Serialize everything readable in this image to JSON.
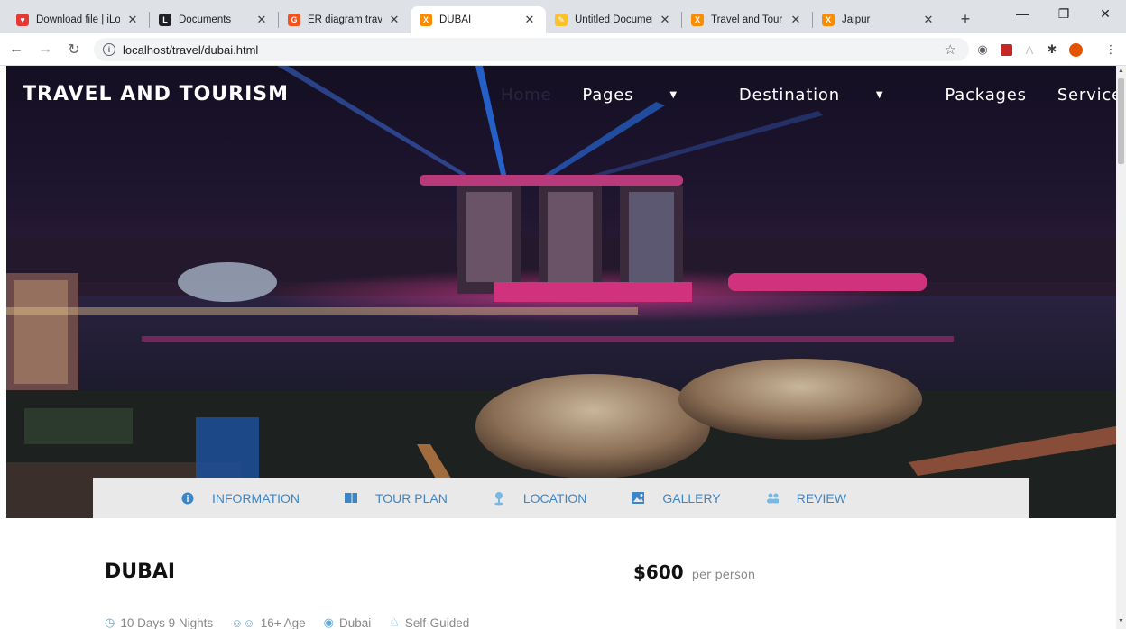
{
  "browser": {
    "tabs": [
      {
        "title": "Download file | iLo",
        "favicon_color": "#e53935",
        "favicon_glyph": "♥",
        "active": false
      },
      {
        "title": "Documents",
        "favicon_color": "#202124",
        "favicon_glyph": "L",
        "active": false
      },
      {
        "title": "ER diagram travel",
        "favicon_color": "#f4511e",
        "favicon_glyph": "G",
        "active": false
      },
      {
        "title": "DUBAI",
        "favicon_color": "#fb8c00",
        "favicon_glyph": "X",
        "active": true
      },
      {
        "title": "Untitled Documen",
        "favicon_color": "#fbc02d",
        "favicon_glyph": "✎",
        "active": false
      },
      {
        "title": "Travel and Tourism",
        "favicon_color": "#fb8c00",
        "favicon_glyph": "X",
        "active": false
      },
      {
        "title": "Jaipur",
        "favicon_color": "#fb8c00",
        "favicon_glyph": "X",
        "active": false
      }
    ],
    "url": "localhost/travel/dubai.html"
  },
  "site": {
    "brand": "TRAVEL AND TOURISM",
    "nav": {
      "home": "Home",
      "pages": "Pages",
      "destination": "Destination",
      "packages": "Packages",
      "services": "Services"
    },
    "subnav": {
      "information": "INFORMATION",
      "tour_plan": "TOUR PLAN",
      "location": "LOCATION",
      "gallery": "GALLERY",
      "review": "REVIEW"
    }
  },
  "package": {
    "title": "DUBAI",
    "price": "$600",
    "price_unit": "per person",
    "duration": "10 Days 9 Nights",
    "age": "16+ Age",
    "place": "Dubai",
    "type": "Self-Guided"
  },
  "colors": {
    "accent_blue": "#3d86c6",
    "subnav_bg": "#e9e9ea"
  }
}
